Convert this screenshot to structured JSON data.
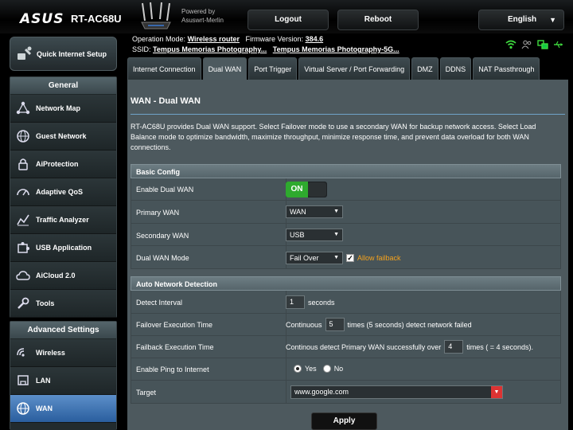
{
  "header": {
    "brand": "ASUS",
    "model": "RT-AC68U",
    "powered_by_line1": "Powered by",
    "powered_by_line2": "Asuswrt-Merlin",
    "logout_label": "Logout",
    "reboot_label": "Reboot",
    "language_label": "English"
  },
  "status": {
    "operation_mode_label": "Operation Mode:",
    "operation_mode_value": "Wireless router",
    "firmware_label": "Firmware Version:",
    "firmware_value": "384.6",
    "ssid_label": "SSID:",
    "ssid_1": "Tempus Memorias Photography...",
    "ssid_2": "Tempus Memorias Photography-5G..."
  },
  "sidebar": {
    "quick_setup_label": "Quick Internet Setup",
    "general_title": "General",
    "general_items": [
      {
        "label": "Network Map",
        "icon": "network-map-icon"
      },
      {
        "label": "Guest Network",
        "icon": "guest-network-icon"
      },
      {
        "label": "AiProtection",
        "icon": "lock-icon"
      },
      {
        "label": "Adaptive QoS",
        "icon": "speedometer-icon"
      },
      {
        "label": "Traffic Analyzer",
        "icon": "chart-icon"
      },
      {
        "label": "USB Application",
        "icon": "puzzle-icon"
      },
      {
        "label": "AiCloud 2.0",
        "icon": "cloud-icon"
      },
      {
        "label": "Tools",
        "icon": "wrench-icon"
      }
    ],
    "advanced_title": "Advanced Settings",
    "advanced_items": [
      {
        "label": "Wireless",
        "icon": "wifi-icon"
      },
      {
        "label": "LAN",
        "icon": "lan-icon"
      },
      {
        "label": "WAN",
        "icon": "globe-icon"
      }
    ]
  },
  "tabs": [
    {
      "label": "Internet Connection"
    },
    {
      "label": "Dual WAN"
    },
    {
      "label": "Port Trigger"
    },
    {
      "label": "Virtual Server / Port Forwarding"
    },
    {
      "label": "DMZ"
    },
    {
      "label": "DDNS"
    },
    {
      "label": "NAT Passthrough"
    }
  ],
  "main": {
    "title": "WAN - Dual WAN",
    "description": "RT-AC68U provides Dual WAN support. Select Failover mode to use a secondary WAN for backup network access. Select Load Balance mode to optimize bandwidth, maximize throughput, minimize response time, and prevent data overload for both WAN connections.",
    "basic_config": {
      "title": "Basic Config",
      "enable_dual_wan_label": "Enable Dual WAN",
      "enable_dual_wan_value": "ON",
      "primary_wan_label": "Primary WAN",
      "primary_wan_value": "WAN",
      "secondary_wan_label": "Secondary WAN",
      "secondary_wan_value": "USB",
      "mode_label": "Dual WAN Mode",
      "mode_value": "Fail Over",
      "allow_failback_label": "Allow failback"
    },
    "auto_detect": {
      "title": "Auto Network Detection",
      "detect_interval_label": "Detect Interval",
      "detect_interval_value": "1",
      "detect_interval_unit": "seconds",
      "failover_label": "Failover Execution Time",
      "failover_prefix": "Continuous",
      "failover_value": "5",
      "failover_suffix": "times (5  seconds) detect network failed",
      "failback_label": "Failback Execution Time",
      "failback_prefix": "Continous detect Primary WAN successfully over",
      "failback_value": "4",
      "failback_suffix": "times ( = 4  seconds).",
      "ping_label": "Enable Ping to Internet",
      "ping_yes": "Yes",
      "ping_no": "No",
      "target_label": "Target",
      "target_value": "www.google.com"
    },
    "apply_label": "Apply"
  }
}
